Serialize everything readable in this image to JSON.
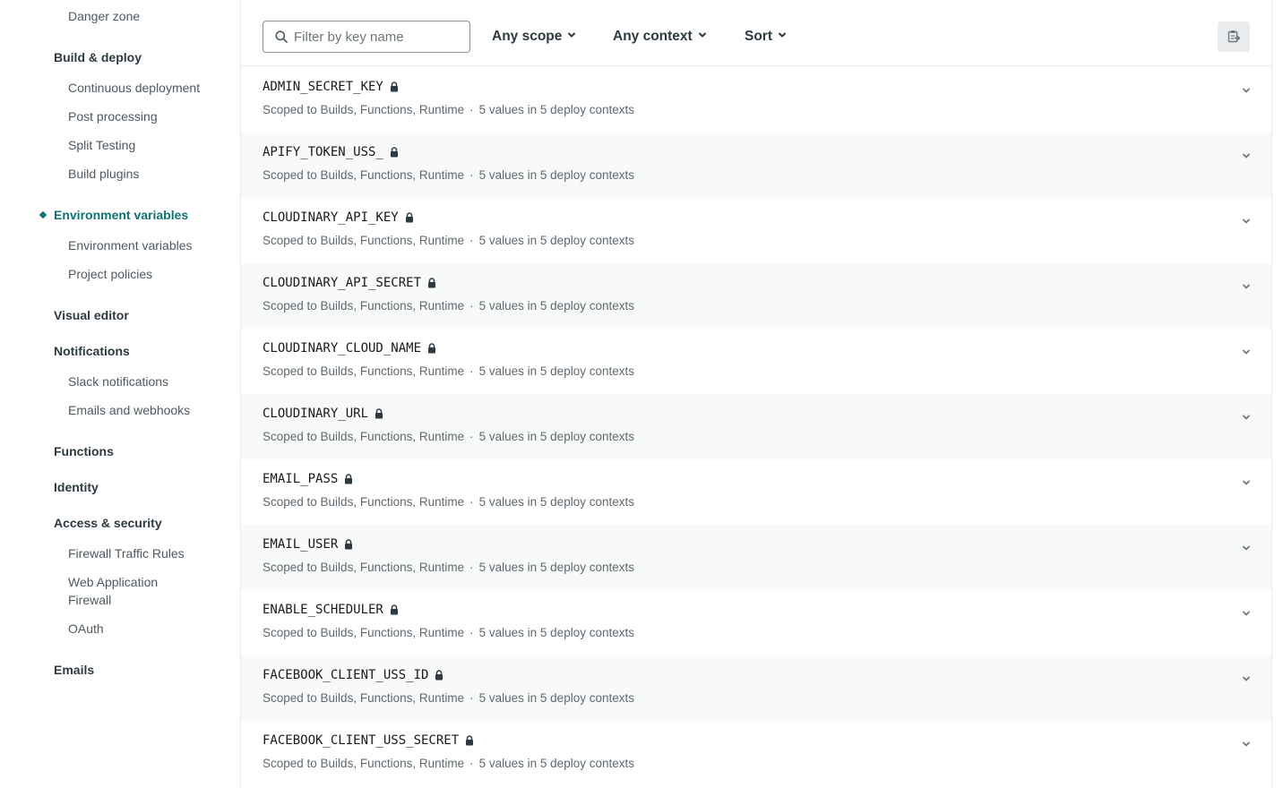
{
  "sidebar": {
    "danger_zone": "Danger zone",
    "build_deploy": "Build & deploy",
    "continuous_deployment": "Continuous deployment",
    "post_processing": "Post processing",
    "split_testing": "Split Testing",
    "build_plugins": "Build plugins",
    "env_vars_group": "Environment variables",
    "env_vars_sub": "Environment variables",
    "project_policies": "Project policies",
    "visual_editor": "Visual editor",
    "notifications": "Notifications",
    "slack_notifications": "Slack notifications",
    "emails_webhooks": "Emails and webhooks",
    "functions": "Functions",
    "identity": "Identity",
    "access_security": "Access & security",
    "firewall_traffic_rules": "Firewall Traffic Rules",
    "waf_line1": "Web Application",
    "waf_line2": "Firewall",
    "oauth": "OAuth",
    "emails": "Emails"
  },
  "toolbar": {
    "search_placeholder": "Filter by key name",
    "scope_label": "Any scope",
    "context_label": "Any context",
    "sort_label": "Sort"
  },
  "rows": [
    {
      "key": "ADMIN_SECRET_KEY",
      "scope": "Scoped to Builds, Functions, Runtime",
      "sep": "·",
      "values": "5 values in 5 deploy contexts"
    },
    {
      "key": "APIFY_TOKEN_USS_",
      "scope": "Scoped to Builds, Functions, Runtime",
      "sep": "·",
      "values": "5 values in 5 deploy contexts"
    },
    {
      "key": "CLOUDINARY_API_KEY",
      "scope": "Scoped to Builds, Functions, Runtime",
      "sep": "·",
      "values": "5 values in 5 deploy contexts"
    },
    {
      "key": "CLOUDINARY_API_SECRET",
      "scope": "Scoped to Builds, Functions, Runtime",
      "sep": "·",
      "values": "5 values in 5 deploy contexts"
    },
    {
      "key": "CLOUDINARY_CLOUD_NAME",
      "scope": "Scoped to Builds, Functions, Runtime",
      "sep": "·",
      "values": "5 values in 5 deploy contexts"
    },
    {
      "key": "CLOUDINARY_URL",
      "scope": "Scoped to Builds, Functions, Runtime",
      "sep": "·",
      "values": "5 values in 5 deploy contexts"
    },
    {
      "key": "EMAIL_PASS",
      "scope": "Scoped to Builds, Functions, Runtime",
      "sep": "·",
      "values": "5 values in 5 deploy contexts"
    },
    {
      "key": "EMAIL_USER",
      "scope": "Scoped to Builds, Functions, Runtime",
      "sep": "·",
      "values": "5 values in 5 deploy contexts"
    },
    {
      "key": "ENABLE_SCHEDULER",
      "scope": "Scoped to Builds, Functions, Runtime",
      "sep": "·",
      "values": "5 values in 5 deploy contexts"
    },
    {
      "key": "FACEBOOK_CLIENT_USS_ID",
      "scope": "Scoped to Builds, Functions, Runtime",
      "sep": "·",
      "values": "5 values in 5 deploy contexts"
    },
    {
      "key": "FACEBOOK_CLIENT_USS_SECRET",
      "scope": "Scoped to Builds, Functions, Runtime",
      "sep": "·",
      "values": "5 values in 5 deploy contexts"
    }
  ],
  "icons": {
    "search": "search-icon",
    "chevron": "chevron-down-icon",
    "lock": "lock-icon",
    "clipboard": "clipboard-import-icon"
  },
  "colors": {
    "accent": "#0d7377",
    "text": "#181a1c",
    "muted": "#5f6a70",
    "row_alt": "#f8f9f9",
    "border": "#e9ebed"
  }
}
